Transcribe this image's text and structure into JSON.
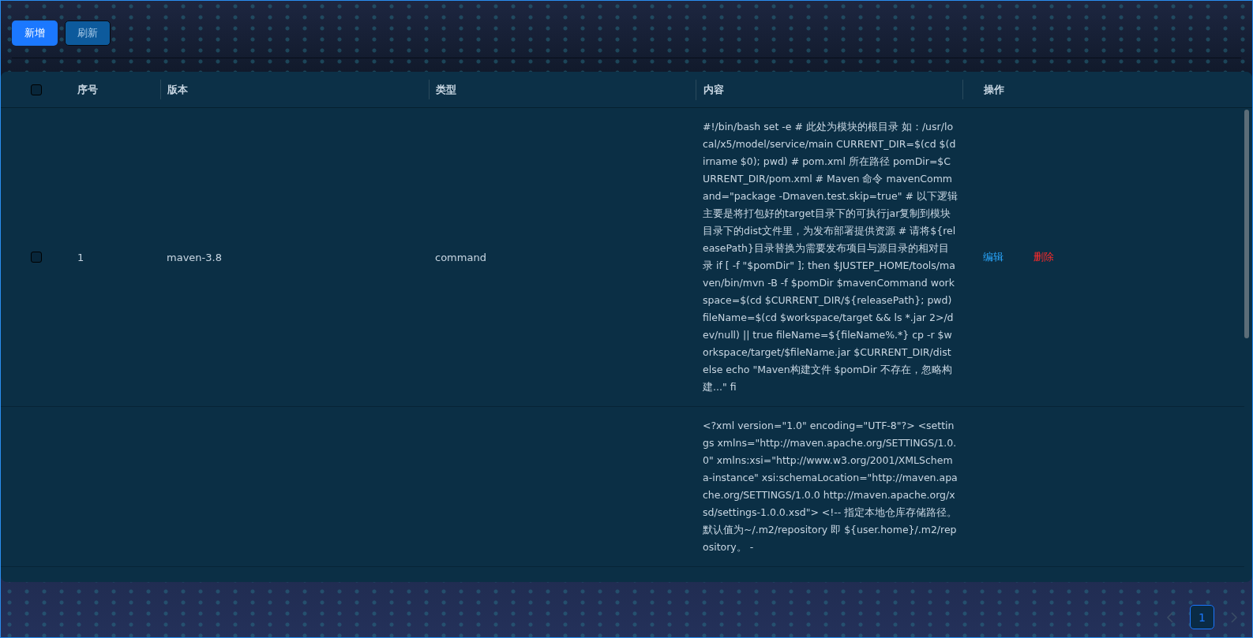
{
  "toolbar": {
    "buttons": [
      {
        "label": "新增",
        "kind": "primary"
      },
      {
        "label": "刷新",
        "kind": "default"
      }
    ]
  },
  "table": {
    "select_all": {
      "checked": false
    },
    "columns": [
      "序号",
      "版本",
      "类型",
      "内容",
      "操作"
    ],
    "rows": [
      {
        "checked": false,
        "index": "1",
        "version": "maven-3.8",
        "type": "command",
        "content": "#!/bin/bash set -e # 此处为模块的根目录 如：/usr/local/x5/model/service/main CURRENT_DIR=$(cd $(dirname $0); pwd) # pom.xml 所在路径 pomDir=$CURRENT_DIR/pom.xml # Maven 命令 mavenCommand=\"package -Dmaven.test.skip=true\" # 以下逻辑主要是将打包好的target目录下的可执行jar复制到模块目录下的dist文件里，为发布部署提供资源 # 请将${releasePath}目录替换为需要发布项目与源目录的相对目录 if [ -f \"$pomDir\" ]; then $JUSTEP_HOME/tools/maven/bin/mvn -B -f $pomDir $mavenCommand workspace=$(cd $CURRENT_DIR/${releasePath}; pwd) fileName=$(cd $workspace/target && ls *.jar 2>/dev/null) || true fileName=${fileName%.*} cp -r $workspace/target/$fileName.jar $CURRENT_DIR/dist else echo \"Maven构建文件 $pomDir 不存在，忽略构建...\" fi",
        "actions": [
          {
            "label": "编辑",
            "kind": "edit"
          },
          {
            "label": "删除",
            "kind": "delete"
          }
        ]
      },
      {
        "content": "<?xml version=\"1.0\" encoding=\"UTF-8\"?> <settings xmlns=\"http://maven.apache.org/SETTINGS/1.0.0\" xmlns:xsi=\"http://www.w3.org/2001/XMLSchema-instance\" xsi:schemaLocation=\"http://maven.apache.org/SETTINGS/1.0.0 http://maven.apache.org/xsd/settings-1.0.0.xsd\"> <!-- 指定本地仓库存储路径。默认值为~/.m2/repository 即 ${user.home}/.m2/repository。 -"
      }
    ]
  },
  "pagination": {
    "prev": {
      "disabled": true
    },
    "pages": [
      {
        "label": "1",
        "selected": true
      }
    ],
    "next": {
      "disabled": true
    }
  }
}
